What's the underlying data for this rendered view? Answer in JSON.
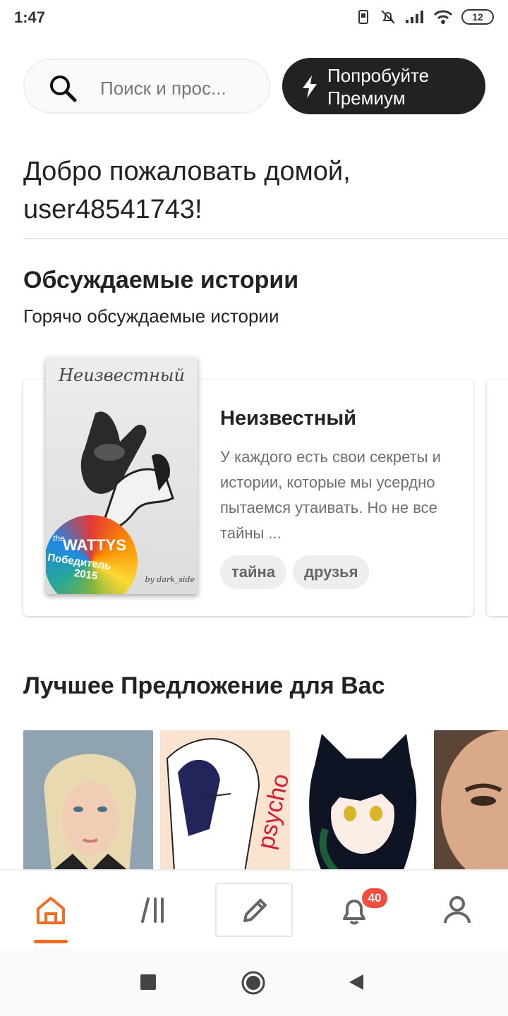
{
  "status_bar": {
    "time": "1:47",
    "battery": "12",
    "icons": [
      "vibrate-icon",
      "mute-alarm-icon",
      "signal-icon",
      "wifi-icon",
      "battery-icon"
    ]
  },
  "search": {
    "placeholder": "Поиск и прос..."
  },
  "premium": {
    "label": "Попробуйте Премиум",
    "icon": "lightning-icon"
  },
  "welcome": {
    "text": "Добро пожаловать домой, user48541743!"
  },
  "discussed": {
    "title": "Обсуждаемые истории",
    "subtitle": "Горячо обсуждаемые истории",
    "story": {
      "cover_title": "Неизвестный",
      "cover_author": "by dark_side",
      "award_top": "the",
      "award_name": "WATTYS",
      "award_line1": "Победитель",
      "award_line2": "2015",
      "title": "Неизвестный",
      "description": "У каждого есть свои секреты и истории, которые мы усердно пытаемся утаивать. Но не все тайны ...",
      "tags": [
        "тайна",
        "друзья"
      ]
    }
  },
  "recommended": {
    "title": "Лучшее Предложение для Вас",
    "cover_text": "psycho"
  },
  "bottom_nav": {
    "items": [
      "home-icon",
      "library-icon",
      "write-icon",
      "notifications-icon",
      "profile-icon"
    ],
    "notifications_count": "40",
    "accent_color": "#f26c23"
  },
  "colors": {
    "accent": "#f26c23",
    "premium_bg": "#222222",
    "badge": "#f04e3e"
  }
}
